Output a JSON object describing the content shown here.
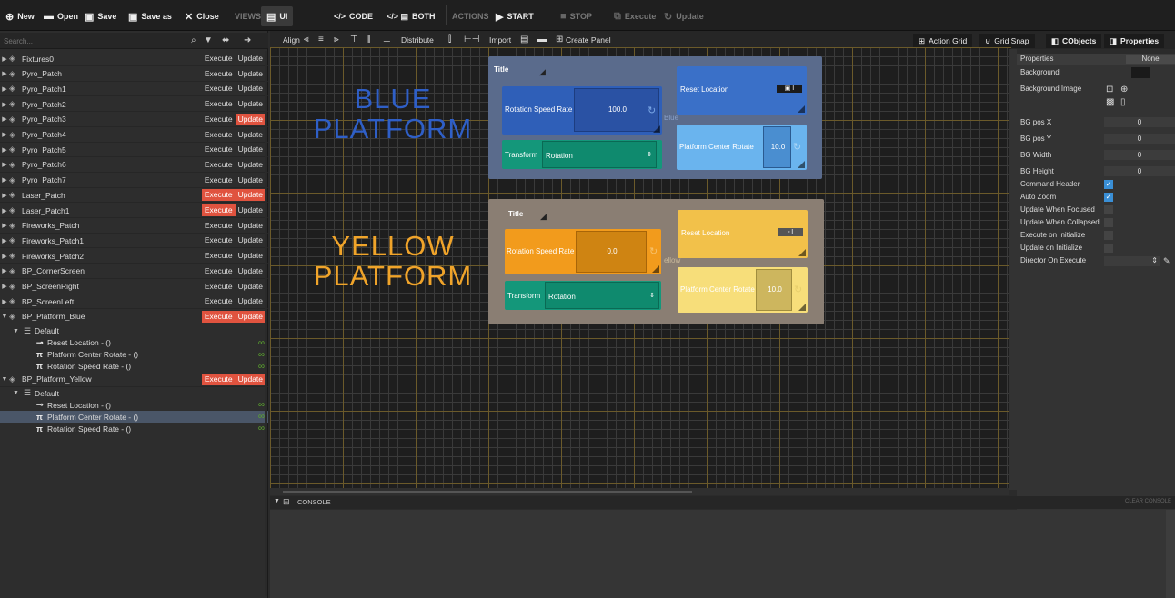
{
  "toolbar": {
    "new": "New",
    "open": "Open",
    "save": "Save",
    "save_as": "Save as",
    "close": "Close",
    "views": "VIEWS",
    "ui": "UI",
    "code": "CODE",
    "both": "BOTH",
    "actions": "ACTIONS",
    "start": "START",
    "stop": "STOP",
    "execute": "Execute",
    "update": "Update"
  },
  "search": {
    "placeholder": "Search..."
  },
  "objects": [
    {
      "name": "Fixtures0",
      "execute": "Execute",
      "update": "Update",
      "exec_red": false,
      "upd_red": false
    },
    {
      "name": "Pyro_Patch",
      "execute": "Execute",
      "update": "Update",
      "exec_red": false,
      "upd_red": false
    },
    {
      "name": "Pyro_Patch1",
      "execute": "Execute",
      "update": "Update",
      "exec_red": false,
      "upd_red": false
    },
    {
      "name": "Pyro_Patch2",
      "execute": "Execute",
      "update": "Update",
      "exec_red": false,
      "upd_red": false
    },
    {
      "name": "Pyro_Patch3",
      "execute": "Execute",
      "update": "Update",
      "exec_red": false,
      "upd_red": true
    },
    {
      "name": "Pyro_Patch4",
      "execute": "Execute",
      "update": "Update",
      "exec_red": false,
      "upd_red": false
    },
    {
      "name": "Pyro_Patch5",
      "execute": "Execute",
      "update": "Update",
      "exec_red": false,
      "upd_red": false
    },
    {
      "name": "Pyro_Patch6",
      "execute": "Execute",
      "update": "Update",
      "exec_red": false,
      "upd_red": false
    },
    {
      "name": "Pyro_Patch7",
      "execute": "Execute",
      "update": "Update",
      "exec_red": false,
      "upd_red": false
    },
    {
      "name": "Laser_Patch",
      "execute": "Execute",
      "update": "Update",
      "exec_red": true,
      "upd_red": true
    },
    {
      "name": "Laser_Patch1",
      "execute": "Execute",
      "update": "Update",
      "exec_red": true,
      "upd_red": false
    },
    {
      "name": "Fireworks_Patch",
      "execute": "Execute",
      "update": "Update",
      "exec_red": false,
      "upd_red": false
    },
    {
      "name": "Fireworks_Patch1",
      "execute": "Execute",
      "update": "Update",
      "exec_red": false,
      "upd_red": false
    },
    {
      "name": "Fireworks_Patch2",
      "execute": "Execute",
      "update": "Update",
      "exec_red": false,
      "upd_red": false
    },
    {
      "name": "BP_CornerScreen",
      "execute": "Execute",
      "update": "Update",
      "exec_red": false,
      "upd_red": false
    },
    {
      "name": "BP_ScreenRight",
      "execute": "Execute",
      "update": "Update",
      "exec_red": false,
      "upd_red": false
    },
    {
      "name": "BP_ScreenLeft",
      "execute": "Execute",
      "update": "Update",
      "exec_red": false,
      "upd_red": false
    },
    {
      "name": "BP_Platform_Blue",
      "execute": "Execute",
      "update": "Update",
      "exec_red": true,
      "upd_red": true
    }
  ],
  "blue_children": {
    "group": "Default",
    "items": [
      "Reset Location - ()",
      "Platform Center Rotate - ()",
      "Rotation Speed Rate - ()"
    ]
  },
  "yellow_object": {
    "name": "BP_Platform_Yellow",
    "execute": "Execute",
    "update": "Update"
  },
  "yellow_children": {
    "group": "Default",
    "items": [
      "Reset Location - ()",
      "Platform Center Rotate - ()",
      "Rotation Speed Rate - ()"
    ]
  },
  "canvas_toolbar": {
    "align": "Align",
    "distribute": "Distribute",
    "import": "Import",
    "create_panel": "Create Panel",
    "action_grid": "Action Grid",
    "grid_snap": "Grid Snap",
    "cobjects": "CObjects",
    "properties": "Properties"
  },
  "blue_panel": {
    "label_line1": "BLUE",
    "label_line2": "PLATFORM",
    "title": "Title",
    "rotation_label": "Rotation Speed Rate",
    "rotation_value": "100.0",
    "reset_label": "Reset Location",
    "center_label": "Platform Center Rotate",
    "center_value": "10.0",
    "transform_label": "Transform",
    "transform_value": "Rotation",
    "ghost_text": "Blue",
    "colors": {
      "panel": "#5a6b8c",
      "rotation": "#2f5fb8",
      "reset": "#3a70c8",
      "center": "#6ab4ee",
      "transform": "#14977a"
    }
  },
  "yellow_panel": {
    "label_line1": "YELLOW",
    "label_line2": "PLATFORM",
    "title": "Title",
    "rotation_label": "Rotation Speed Rate",
    "rotation_value": "0.0",
    "reset_label": "Reset Location",
    "center_label": "Platform Center Rotate",
    "center_value": "10.0",
    "transform_label": "Transform",
    "transform_value": "Rotation",
    "ghost_text": "ellow",
    "colors": {
      "panel": "#8a7e73",
      "rotation": "#f29b1c",
      "reset": "#f2c14a",
      "center": "#f7de7a",
      "transform": "#14977a"
    }
  },
  "properties": {
    "header": "Properties",
    "header_value": "None",
    "background": "Background",
    "background_image": "Background Image",
    "bg_pos_x": "BG pos X",
    "bg_pos_x_val": "0",
    "bg_pos_y": "BG pos Y",
    "bg_pos_y_val": "0",
    "bg_width": "BG Width",
    "bg_width_val": "0",
    "bg_height": "BG Height",
    "bg_height_val": "0",
    "command_header": "Command Header",
    "command_header_on": true,
    "auto_zoom": "Auto Zoom",
    "auto_zoom_on": true,
    "update_focused": "Update When Focused",
    "update_focused_on": false,
    "update_collapsed": "Update When Collapsed",
    "update_collapsed_on": false,
    "exec_init": "Execute on Initialize",
    "exec_init_on": false,
    "update_init": "Update on Initialize",
    "update_init_on": false,
    "director": "Director On Execute"
  },
  "console": {
    "label": "CONSOLE",
    "clear": "CLEAR CONSOLE"
  }
}
